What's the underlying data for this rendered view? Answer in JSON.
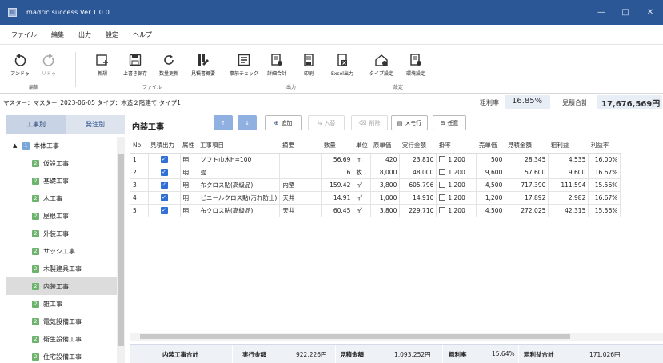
{
  "window": {
    "title": "madric success Ver.1.0.0",
    "controls": [
      "—",
      "□",
      "✕"
    ]
  },
  "menu": [
    "ファイル",
    "編集",
    "出力",
    "設定",
    "ヘルプ"
  ],
  "ribbon": {
    "buttons": [
      {
        "label": "アンドゥ",
        "icon": "undo-icon",
        "enabled": true
      },
      {
        "label": "リドゥ",
        "icon": "redo-icon",
        "enabled": false
      },
      {
        "label": "新規",
        "icon": "new-icon",
        "enabled": true
      },
      {
        "label": "上書き保存",
        "icon": "save-icon",
        "enabled": true
      },
      {
        "label": "数量更新",
        "icon": "refresh-icon",
        "enabled": true
      },
      {
        "label": "見積書概要",
        "icon": "estimate-summary-icon",
        "enabled": true
      },
      {
        "label": "事前チェック",
        "icon": "precheck-icon",
        "enabled": true
      },
      {
        "label": "詳細合計",
        "icon": "detail-total-icon",
        "enabled": true
      },
      {
        "label": "印刷",
        "icon": "print-icon",
        "enabled": true
      },
      {
        "label": "Excel出力",
        "icon": "excel-icon",
        "enabled": true
      },
      {
        "label": "タイプ設定",
        "icon": "type-settings-icon",
        "enabled": true
      },
      {
        "label": "環境設定",
        "icon": "env-settings-icon",
        "enabled": true
      }
    ],
    "groups": [
      "編集",
      "ファイル",
      "出力",
      "設定"
    ]
  },
  "master": {
    "text": "マスター：マスター_2023-06-05 タイプ：木造２階建て タイプ1",
    "rate_label": "粗利率",
    "rate_value": "16.85%",
    "total_label": "見積合計",
    "total_value": "17,676,569円"
  },
  "tabs": [
    "工事別",
    "発注別"
  ],
  "tree": {
    "root": "本体工事",
    "root_badge": "1",
    "items_badge": "2",
    "selected": "内装工事",
    "items": [
      "仮設工事",
      "基礎工事",
      "木工事",
      "屋根工事",
      "外装工事",
      "サッシ工事",
      "木製建具工事",
      "内装工事",
      "雑工事",
      "電気設備工事",
      "衛生設備工事",
      "住宅設備工事"
    ]
  },
  "section": {
    "title": "内装工事",
    "buttons": {
      "up": "↑",
      "down": "↓",
      "add": "追加",
      "replace": "入替",
      "delete": "削除",
      "memo": "メモ行",
      "any": "任意"
    }
  },
  "table": {
    "headers": [
      "No",
      "見積出力",
      "属性",
      "工事項目",
      "摘要",
      "数量",
      "単位",
      "原単価",
      "実行金額",
      "掛率",
      "売単価",
      "見積金額",
      "粗利益",
      "利益率"
    ],
    "rows": [
      [
        "1",
        "✓",
        "明",
        "ソフト巾木H=100",
        "",
        "56.69",
        "m",
        "420",
        "23,810",
        "1.200",
        "500",
        "28,345",
        "4,535",
        "16.00%"
      ],
      [
        "2",
        "✓",
        "明",
        "畳",
        "",
        "6",
        "枚",
        "8,000",
        "48,000",
        "1.200",
        "9,600",
        "57,600",
        "9,600",
        "16.67%"
      ],
      [
        "3",
        "✓",
        "明",
        "布クロス貼(高級品)",
        "内壁",
        "159.42",
        "㎡",
        "3,800",
        "605,796",
        "1.200",
        "4,500",
        "717,390",
        "111,594",
        "15.56%"
      ],
      [
        "4",
        "✓",
        "明",
        "ビニールクロス貼(汚れ防止)",
        "天井",
        "14.91",
        "㎡",
        "1,000",
        "14,910",
        "1.200",
        "1,200",
        "17,892",
        "2,982",
        "16.67%"
      ],
      [
        "5",
        "✓",
        "明",
        "布クロス貼(高級品)",
        "天井",
        "60.45",
        "㎡",
        "3,800",
        "229,710",
        "1.200",
        "4,500",
        "272,025",
        "42,315",
        "15.56%"
      ]
    ]
  },
  "footer": {
    "title": "内装工事合計",
    "exec_label": "実行金額",
    "exec_value": "922,226円",
    "est_label": "見積金額",
    "est_value": "1,093,252円",
    "rate_label": "粗利率",
    "rate_value": "15.64%",
    "profit_label": "粗利益合計",
    "profit_value": "171,026円"
  },
  "colors": {
    "titlebar": "#2b5797",
    "accent": "#2f6fd6",
    "tree_badge": "#6db36d",
    "panel": "#e8eef6"
  }
}
